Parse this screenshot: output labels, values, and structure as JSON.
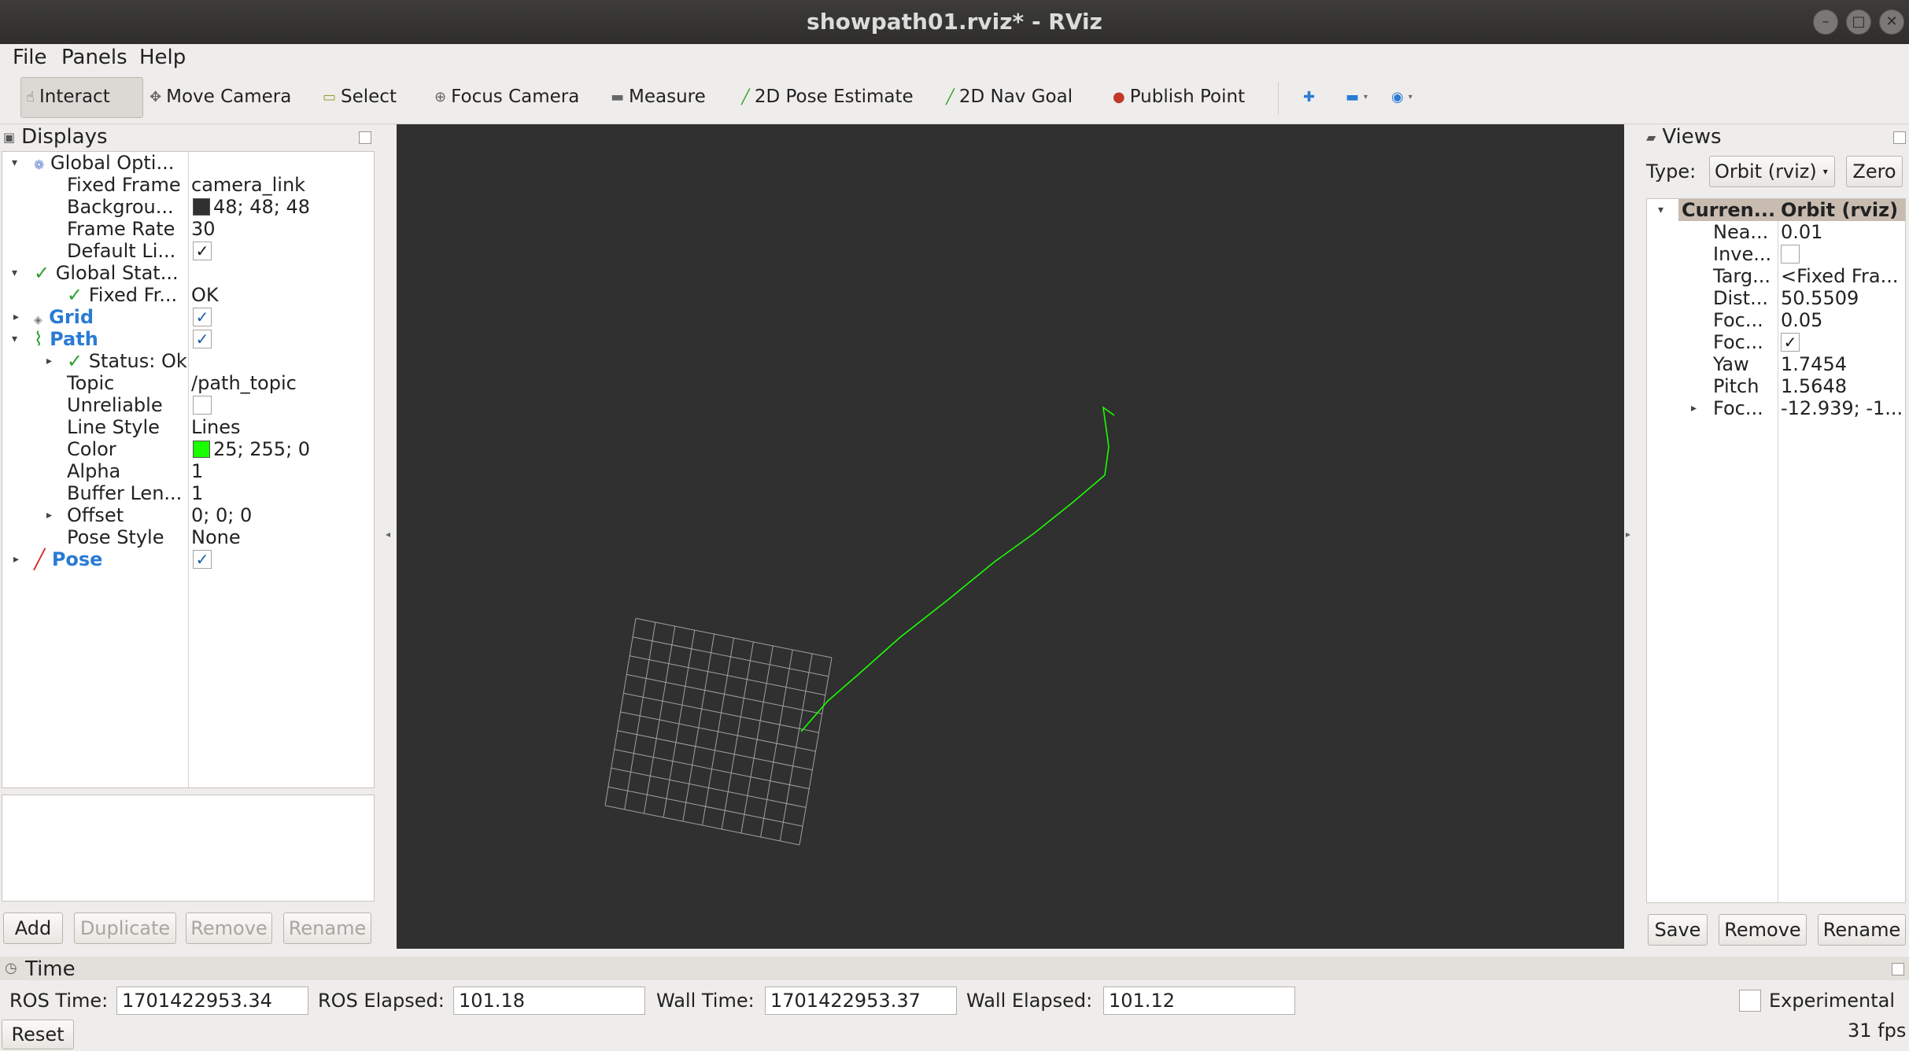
{
  "window": {
    "title": "showpath01.rviz* - RViz"
  },
  "menu": {
    "file": "File",
    "panels": "Panels",
    "help": "Help"
  },
  "toolbar": {
    "interact": "Interact",
    "move_camera": "Move Camera",
    "select": "Select",
    "focus_camera": "Focus Camera",
    "measure": "Measure",
    "pose_estimate": "2D Pose Estimate",
    "nav_goal": "2D Nav Goal",
    "publish_point": "Publish Point"
  },
  "displays": {
    "title": "Displays",
    "global_options": {
      "label": "Global Opti...",
      "fixed_frame_label": "Fixed Frame",
      "fixed_frame_value": "camera_link",
      "background_label": "Backgrou...",
      "background_value": "48; 48; 48",
      "background_color": "#303030",
      "frame_rate_label": "Frame Rate",
      "frame_rate_value": "30",
      "default_light_label": "Default Li..."
    },
    "global_status": {
      "label": "Global Stat...",
      "fixed_frame_label": "Fixed Fr...",
      "fixed_frame_value": "OK"
    },
    "grid": {
      "label": "Grid"
    },
    "path": {
      "label": "Path",
      "status_label": "Status: Ok",
      "topic_label": "Topic",
      "topic_value": "/path_topic",
      "unreliable_label": "Unreliable",
      "line_style_label": "Line Style",
      "line_style_value": "Lines",
      "color_label": "Color",
      "color_value": "25; 255; 0",
      "color": "#19ff00",
      "alpha_label": "Alpha",
      "alpha_value": "1",
      "buffer_label": "Buffer Len...",
      "buffer_value": "1",
      "offset_label": "Offset",
      "offset_value": "0; 0; 0",
      "pose_style_label": "Pose Style",
      "pose_style_value": "None"
    },
    "pose": {
      "label": "Pose"
    },
    "buttons": {
      "add": "Add",
      "duplicate": "Duplicate",
      "remove": "Remove",
      "rename": "Rename"
    }
  },
  "viewport": {
    "background": "#303030",
    "grid_color": "#a0a0a0",
    "path_color": "#19ff00"
  },
  "views": {
    "title": "Views",
    "type_label": "Type:",
    "type_value": "Orbit (rviz)",
    "zero": "Zero",
    "current_label": "Curren...",
    "current_value": "Orbit (rviz)",
    "props": {
      "near_label": "Nea...",
      "near_value": "0.01",
      "invert_label": "Inve...",
      "target_label": "Targ...",
      "target_value": "<Fixed Fra...",
      "distance_label": "Dist...",
      "distance_value": "50.5509",
      "focal_size_label": "Foc...",
      "focal_size_value": "0.05",
      "focal_shape_label": "Foc...",
      "yaw_label": "Yaw",
      "yaw_value": "1.7454",
      "pitch_label": "Pitch",
      "pitch_value": "1.5648",
      "focal_point_label": "Foc...",
      "focal_point_value": "-12.939; -1..."
    },
    "buttons": {
      "save": "Save",
      "remove": "Remove",
      "rename": "Rename"
    }
  },
  "time": {
    "title": "Time",
    "ros_time_label": "ROS Time:",
    "ros_time_value": "1701422953.34",
    "ros_elapsed_label": "ROS Elapsed:",
    "ros_elapsed_value": "101.18",
    "wall_time_label": "Wall Time:",
    "wall_time_value": "1701422953.37",
    "wall_elapsed_label": "Wall Elapsed:",
    "wall_elapsed_value": "101.12",
    "experimental_label": "Experimental",
    "reset": "Reset",
    "fps": "31 fps"
  }
}
